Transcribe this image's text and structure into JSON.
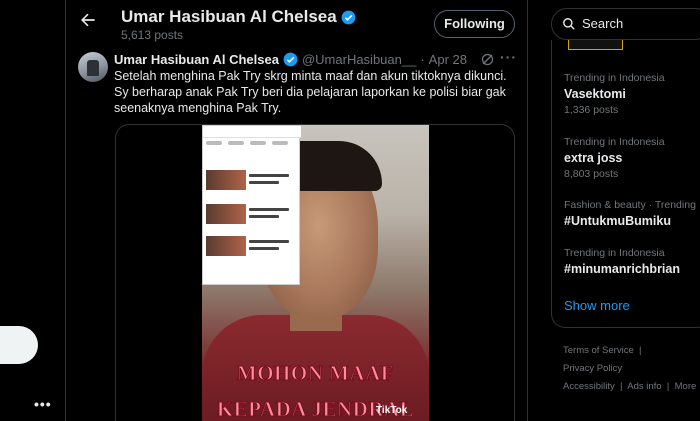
{
  "header": {
    "title": "Umar Hasibuan Al Chelsea",
    "posts_count": "5,613 posts",
    "follow_label": "Following"
  },
  "tweet": {
    "author_name": "Umar Hasibuan Al Chelsea",
    "handle": "@UmarHasibuan__",
    "separator": "·",
    "date": "Apr 28",
    "text": "Setelah menghina Pak Try skrg minta maaf dan akun tiktoknya dikunci. Sy berharap anak Pak Try beri dia pelajaran laporkan ke polisi biar gak seenaknya menghina Pak Try.",
    "video_caption_line1": "MOHON MAAF",
    "video_caption_line2": "KEPADA JENDRAL",
    "video_watermark": "TikTok"
  },
  "search": {
    "placeholder": "Search"
  },
  "trends": [
    {
      "context": "Trending in Indonesia",
      "name": "Vasektomi",
      "count": "1,336 posts"
    },
    {
      "context": "Trending in Indonesia",
      "name": "extra joss",
      "count": "8,803 posts"
    },
    {
      "context": "Fashion & beauty · Trending",
      "name": "#UntukmuBumiku",
      "count": ""
    },
    {
      "context": "Trending in Indonesia",
      "name": "#minumanrichbrian",
      "count": ""
    }
  ],
  "show_more": "Show more",
  "footer": {
    "terms": "Terms of Service",
    "privacy": "Privacy Policy",
    "accessibility": "Accessibility",
    "ads": "Ads info",
    "more": "More"
  },
  "colors": {
    "accent": "#1d9bf0",
    "background": "#000000",
    "border": "#2f3336",
    "muted": "#71767b"
  },
  "icons": [
    "back-arrow-icon",
    "verified-badge-icon",
    "grok-icon",
    "more-icon",
    "search-icon"
  ]
}
